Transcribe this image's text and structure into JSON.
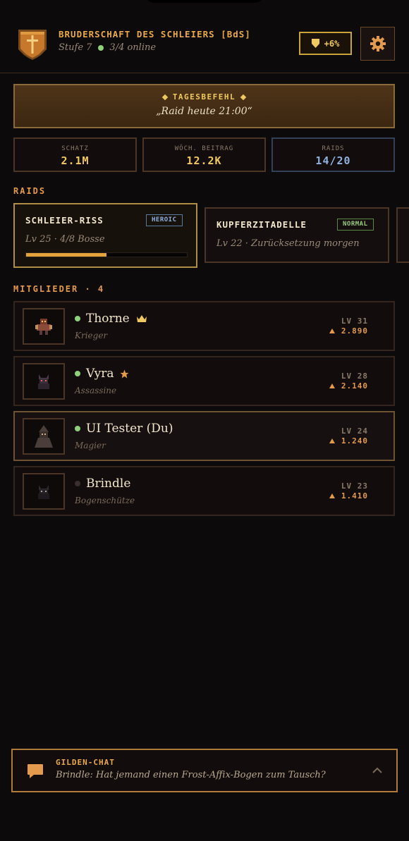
{
  "guild": {
    "name": "BRUDERSCHAFT DES SCHLEIERS [BdS]",
    "level": "Stufe 7",
    "online": "3/4 online",
    "bonus": "+6%"
  },
  "order": {
    "label": "TAGESBEFEHL",
    "text": "„Raid heute 21:00“"
  },
  "stats": [
    {
      "label": "SCHATZ",
      "value": "2.1M"
    },
    {
      "label": "WÖCH. BEITRAG",
      "value": "12.2K"
    },
    {
      "label": "RAIDS",
      "value": "14/20"
    }
  ],
  "raids_title": "RAIDS",
  "raids": [
    {
      "name": "SCHLEIER-RISS",
      "badge": "HEROIC",
      "info": "Lv 25 · 4/8 Bosse",
      "progress": 0.5
    },
    {
      "name": "KUPFERZITADELLE",
      "badge": "NORMAL",
      "info": "Lv 22 · Zurücksetzung morgen"
    }
  ],
  "members_title": "MITGLIEDER · 4",
  "members": [
    {
      "name": "Thorne",
      "class": "Krieger",
      "level": "LV 31",
      "power": "2.890",
      "online": true,
      "tag": "crown-icon"
    },
    {
      "name": "Vyra",
      "class": "Assassine",
      "level": "LV 28",
      "power": "2.140",
      "online": true,
      "tag": "star-icon"
    },
    {
      "name": "UI Tester (Du)",
      "class": "Magier",
      "level": "LV 24",
      "power": "1.240",
      "online": true,
      "tag": ""
    },
    {
      "name": "Brindle",
      "class": "Bogenschütze",
      "level": "LV 23",
      "power": "1.410",
      "online": false,
      "tag": ""
    }
  ],
  "chat": {
    "title": "GILDEN-CHAT",
    "message": "Brindle: Hat jemand einen Frost-Affix-Bogen zum Tausch?"
  },
  "colors": {
    "accent": "#e9a94a",
    "gold": "#f0c860",
    "online": "#8fd07a",
    "heroic": "#8fb0e0",
    "normal": "#9acb7a"
  }
}
